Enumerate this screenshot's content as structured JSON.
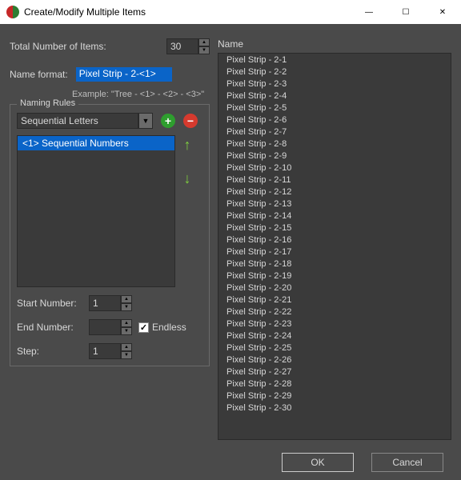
{
  "window": {
    "title": "Create/Modify Multiple Items"
  },
  "left": {
    "total_label": "Total Number of Items:",
    "total_value": "30",
    "name_format_label": "Name format:",
    "name_format_value": "Pixel Strip - 2-<1>",
    "example": "Example: \"Tree - <1> - <2> - <3>\"",
    "rules_legend": "Naming Rules",
    "rule_type": "Sequential Letters",
    "rule_item": "<1> Sequential Numbers",
    "start_label": "Start Number:",
    "start_value": "1",
    "end_label": "End Number:",
    "end_value": "",
    "endless_label": "Endless",
    "step_label": "Step:",
    "step_value": "1"
  },
  "right": {
    "header": "Name",
    "items": [
      "Pixel Strip - 2-1",
      "Pixel Strip - 2-2",
      "Pixel Strip - 2-3",
      "Pixel Strip - 2-4",
      "Pixel Strip - 2-5",
      "Pixel Strip - 2-6",
      "Pixel Strip - 2-7",
      "Pixel Strip - 2-8",
      "Pixel Strip - 2-9",
      "Pixel Strip - 2-10",
      "Pixel Strip - 2-11",
      "Pixel Strip - 2-12",
      "Pixel Strip - 2-13",
      "Pixel Strip - 2-14",
      "Pixel Strip - 2-15",
      "Pixel Strip - 2-16",
      "Pixel Strip - 2-17",
      "Pixel Strip - 2-18",
      "Pixel Strip - 2-19",
      "Pixel Strip - 2-20",
      "Pixel Strip - 2-21",
      "Pixel Strip - 2-22",
      "Pixel Strip - 2-23",
      "Pixel Strip - 2-24",
      "Pixel Strip - 2-25",
      "Pixel Strip - 2-26",
      "Pixel Strip - 2-27",
      "Pixel Strip - 2-28",
      "Pixel Strip - 2-29",
      "Pixel Strip - 2-30"
    ]
  },
  "footer": {
    "ok": "OK",
    "cancel": "Cancel"
  }
}
